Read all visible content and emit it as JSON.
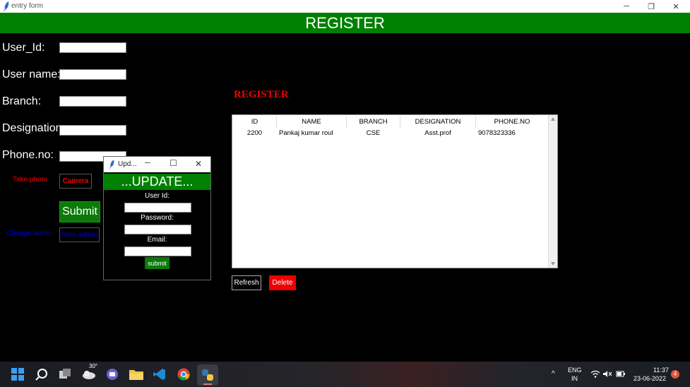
{
  "window": {
    "title": "entry form",
    "minimize": "─",
    "restore": "❐",
    "close": "✕"
  },
  "header": {
    "title": "REGISTER"
  },
  "form": {
    "user_id_label": "User_Id:",
    "user_name_label": "User name:",
    "branch_label": "Branch:",
    "designation_label": "Designation:",
    "phone_label": "Phone.no:",
    "take_photo": "Take photo",
    "camera": "Camera",
    "submit": "Submit",
    "change_admin": "Change admin",
    "new_admin": "New admin"
  },
  "register_title": "REGISTER",
  "table": {
    "headers": [
      "ID",
      "NAME",
      "BRANCH",
      "DESIGNATION",
      "PHONE.NO"
    ],
    "rows": [
      [
        "2200",
        "Pankaj kumar roul",
        "CSE",
        "Asst.prof",
        "9078323336"
      ]
    ]
  },
  "buttons": {
    "refresh": "Refresh",
    "delete": "Delete"
  },
  "popup": {
    "title": "Upd...",
    "heading": "...UPDATE...",
    "user_id_label": "User Id:",
    "password_label": "Password:",
    "email_label": "Email:",
    "submit": "submit",
    "minimize": "─",
    "restore": "☐",
    "close": "✕"
  },
  "taskbar": {
    "weather_temp": "30°",
    "lang_top": "ENG",
    "lang_bottom": "IN",
    "time": "11:37",
    "date": "23-06-2022",
    "notification_count": "4",
    "chevron": "^"
  },
  "colors": {
    "header_green": "#008000",
    "accent_red": "#e00000",
    "link_blue": "#0000cc"
  }
}
